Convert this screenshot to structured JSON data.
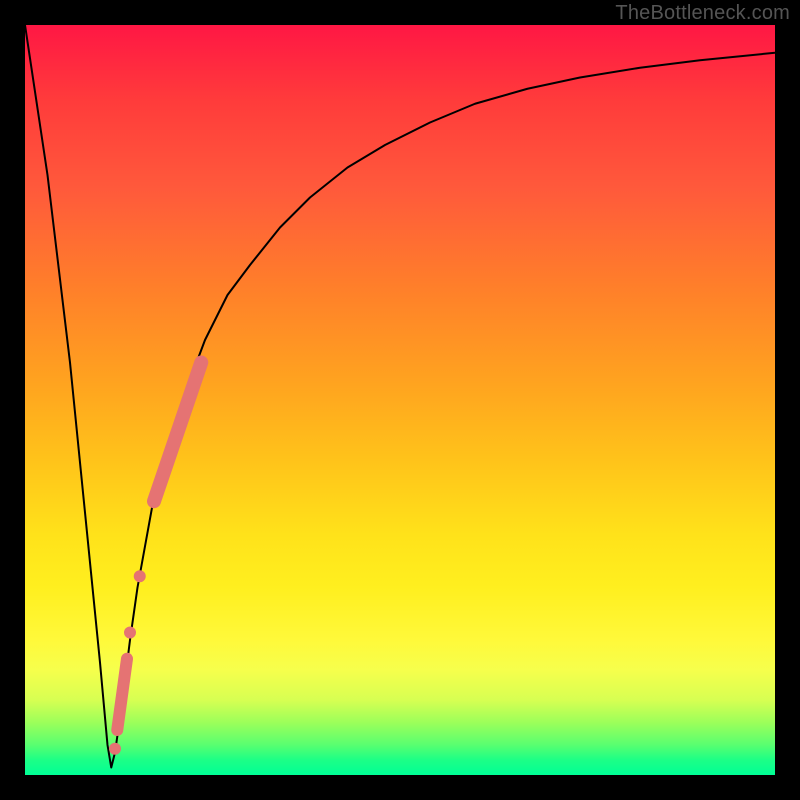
{
  "watermark": "TheBottleneck.com",
  "chart_data": {
    "type": "line",
    "title": "",
    "xlabel": "",
    "ylabel": "",
    "xlim": [
      0,
      100
    ],
    "ylim": [
      0,
      100
    ],
    "grid": false,
    "legend": false,
    "series": [
      {
        "name": "bottleneck-curve",
        "color": "#000000",
        "x": [
          0,
          3,
          6,
          8,
          10,
          11,
          11.5,
          12,
          13,
          14,
          15,
          17,
          19,
          21,
          24,
          27,
          30,
          34,
          38,
          43,
          48,
          54,
          60,
          67,
          74,
          82,
          90,
          100
        ],
        "values": [
          100,
          80,
          55,
          35,
          15,
          4,
          1,
          3,
          10,
          18,
          25,
          36,
          44,
          50,
          58,
          64,
          68,
          73,
          77,
          81,
          84,
          87,
          89.5,
          91.5,
          93,
          94.3,
          95.3,
          96.3
        ]
      }
    ],
    "markers": [
      {
        "name": "highlight-segment",
        "color": "#e57373",
        "style": "thick-line",
        "x": [
          17.2,
          23.5
        ],
        "values": [
          36.5,
          55.0
        ]
      },
      {
        "name": "dot-1",
        "color": "#e57373",
        "style": "dot",
        "x": [
          15.3
        ],
        "values": [
          26.5
        ]
      },
      {
        "name": "dot-2",
        "color": "#e57373",
        "style": "dot",
        "x": [
          14.0
        ],
        "values": [
          19.0
        ]
      },
      {
        "name": "highlight-small",
        "color": "#e57373",
        "style": "thick-line-short",
        "x": [
          12.3,
          13.6
        ],
        "values": [
          6.0,
          15.5
        ]
      },
      {
        "name": "dot-3",
        "color": "#e57373",
        "style": "dot",
        "x": [
          12.0
        ],
        "values": [
          3.5
        ]
      }
    ],
    "background": {
      "type": "vertical-gradient",
      "stops": [
        {
          "pos": 0.0,
          "color": "#ff1744"
        },
        {
          "pos": 0.35,
          "color": "#ff7f2a"
        },
        {
          "pos": 0.68,
          "color": "#ffe21a"
        },
        {
          "pos": 0.9,
          "color": "#d7ff52"
        },
        {
          "pos": 1.0,
          "color": "#00ff96"
        }
      ]
    }
  }
}
